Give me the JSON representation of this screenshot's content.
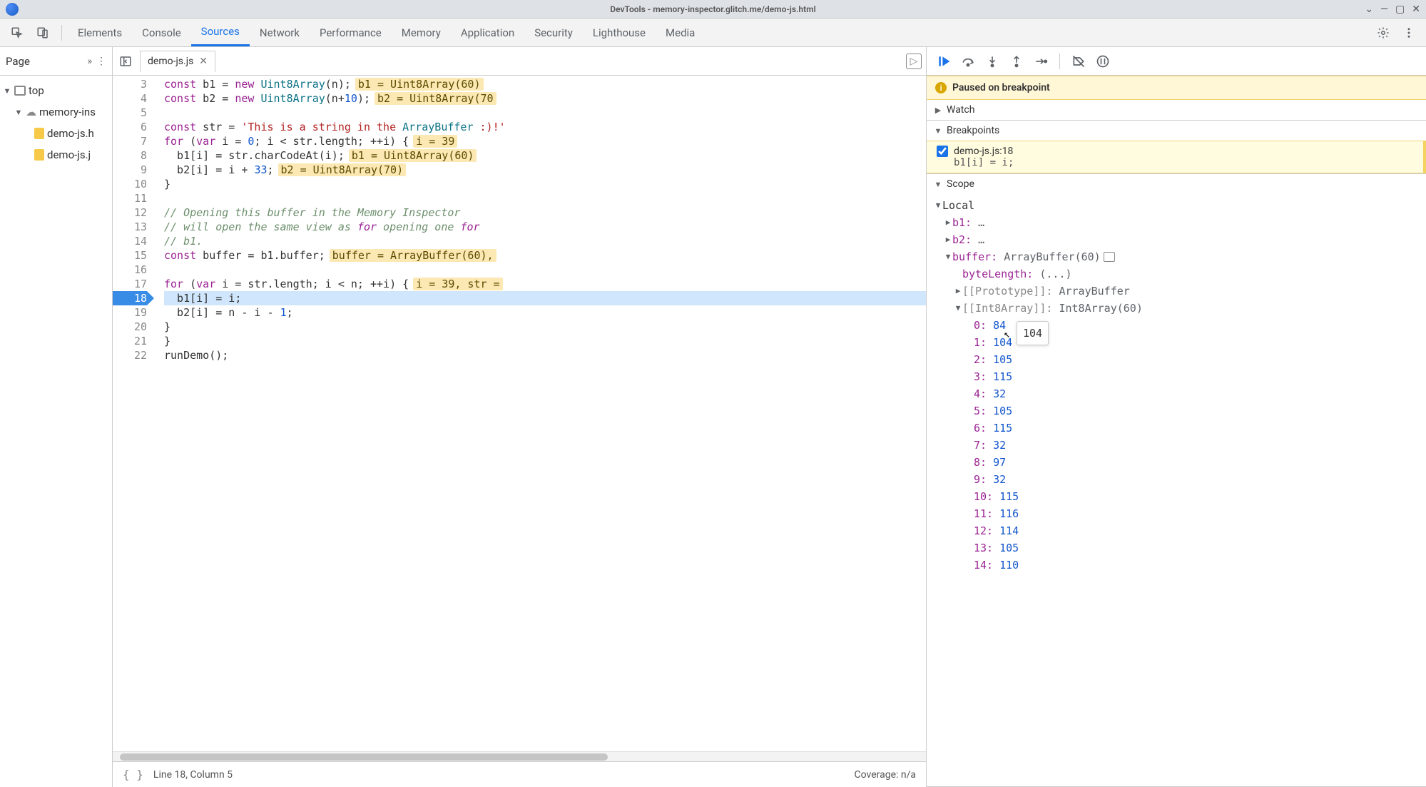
{
  "window_title": "DevTools - memory-inspector.glitch.me/demo-js.html",
  "tabs": [
    "Elements",
    "Console",
    "Sources",
    "Network",
    "Performance",
    "Memory",
    "Application",
    "Security",
    "Lighthouse",
    "Media"
  ],
  "active_tab": "Sources",
  "page_label": "Page",
  "tree": {
    "top": "top",
    "domain": "memory-ins",
    "files": [
      "demo-js.h",
      "demo-js.j"
    ]
  },
  "file_tab": "demo-js.js",
  "gutter_start": 3,
  "gutter_end": 22,
  "breakpoint_line": 18,
  "code": {
    "l3": {
      "text": "const b1 = new Uint8Array(n);",
      "hint": "b1 = Uint8Array(60)"
    },
    "l4": {
      "text": "const b2 = new Uint8Array(n+10);",
      "hint": "b2 = Uint8Array(70"
    },
    "l5": {
      "text": ""
    },
    "l6": {
      "text": "const str = 'This is a string in the ArrayBuffer :)!'"
    },
    "l7": {
      "text": "for (var i = 0; i < str.length; ++i) {",
      "hint": "i = 39"
    },
    "l8": {
      "text": "  b1[i] = str.charCodeAt(i);",
      "hint": "b1 = Uint8Array(60)"
    },
    "l9": {
      "text": "  b2[i] = i + 33;",
      "hint": "b2 = Uint8Array(70)"
    },
    "l10": {
      "text": "}"
    },
    "l11": {
      "text": ""
    },
    "l12": {
      "text": "// Opening this buffer in the Memory Inspector"
    },
    "l13": {
      "text": "// will open the same view as for opening one for"
    },
    "l14": {
      "text": "// b1."
    },
    "l15": {
      "text": "const buffer = b1.buffer;",
      "hint": "buffer = ArrayBuffer(60),"
    },
    "l16": {
      "text": ""
    },
    "l17": {
      "text": "for (var i = str.length; i < n; ++i) {",
      "hint": "i = 39, str ="
    },
    "l18": {
      "text": "  b1[i] = i;"
    },
    "l19": {
      "text": "  b2[i] = n - i - 1;"
    },
    "l20": {
      "text": "}"
    },
    "l21": {
      "text": "}"
    },
    "l22": {
      "text": "runDemo();"
    }
  },
  "status_pos": "Line 18, Column 5",
  "status_cov": "Coverage: n/a",
  "paused_text": "Paused on breakpoint",
  "sections": {
    "watch": "Watch",
    "breakpoints": "Breakpoints",
    "scope": "Scope"
  },
  "breakpoint": {
    "label": "demo-js.js:18",
    "expr": "b1[i] = i;"
  },
  "scope": {
    "local": "Local",
    "b1": "b1:",
    "b1v": "…",
    "b2": "b2:",
    "b2v": "…",
    "buffer_k": "buffer:",
    "buffer_v": "ArrayBuffer(60)",
    "byteLength_k": "byteLength:",
    "byteLength_v": "(...)",
    "proto_k": "[[Prototype]]:",
    "proto_v": "ArrayBuffer",
    "int8_k": "[[Int8Array]]:",
    "int8_v": "Int8Array(60)",
    "entries": [
      {
        "i": 0,
        "v": 84
      },
      {
        "i": 1,
        "v": 104
      },
      {
        "i": 2,
        "v": 105
      },
      {
        "i": 3,
        "v": 115
      },
      {
        "i": 4,
        "v": 32
      },
      {
        "i": 5,
        "v": 105
      },
      {
        "i": 6,
        "v": 115
      },
      {
        "i": 7,
        "v": 32
      },
      {
        "i": 8,
        "v": 97
      },
      {
        "i": 9,
        "v": 32
      },
      {
        "i": 10,
        "v": 115
      },
      {
        "i": 11,
        "v": 116
      },
      {
        "i": 12,
        "v": 114
      },
      {
        "i": 13,
        "v": 105
      },
      {
        "i": 14,
        "v": 110
      }
    ]
  },
  "tooltip_value": "104"
}
